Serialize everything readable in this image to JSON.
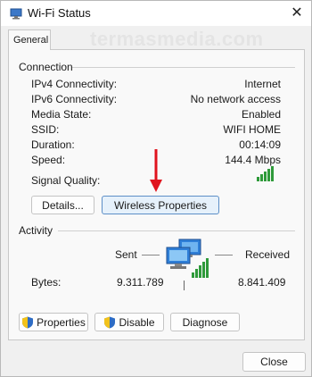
{
  "window": {
    "title": "Wi-Fi Status",
    "close_glyph": "✕"
  },
  "watermark": "termasmedia.com",
  "tabs": [
    {
      "label": "General"
    }
  ],
  "connection": {
    "heading": "Connection",
    "rows": [
      {
        "label": "IPv4 Connectivity:",
        "value": "Internet"
      },
      {
        "label": "IPv6 Connectivity:",
        "value": "No network access"
      },
      {
        "label": "Media State:",
        "value": "Enabled"
      },
      {
        "label": "SSID:",
        "value": "WIFI HOME"
      },
      {
        "label": "Duration:",
        "value": "00:14:09"
      },
      {
        "label": "Speed:",
        "value": "144.4 Mbps"
      }
    ],
    "signal_label": "Signal Quality:",
    "signal_icon": "signal-bars-icon"
  },
  "buttons": {
    "details": "Details...",
    "wireless_properties": "Wireless Properties",
    "properties": "Properties",
    "disable": "Disable",
    "diagnose": "Diagnose",
    "close": "Close"
  },
  "activity": {
    "heading": "Activity",
    "sent_label": "Sent",
    "received_label": "Received",
    "bytes_label": "Bytes:",
    "sent_bytes": "9.311.789",
    "received_bytes": "8.841.409",
    "network_icon": "network-computers-icon"
  },
  "colors": {
    "signal_green": "#2e9a3a",
    "arrow_red": "#e0141e",
    "focus_blue": "#5d8fc7",
    "shield_blue": "#2d6cc4",
    "shield_yellow": "#f2c21a"
  }
}
